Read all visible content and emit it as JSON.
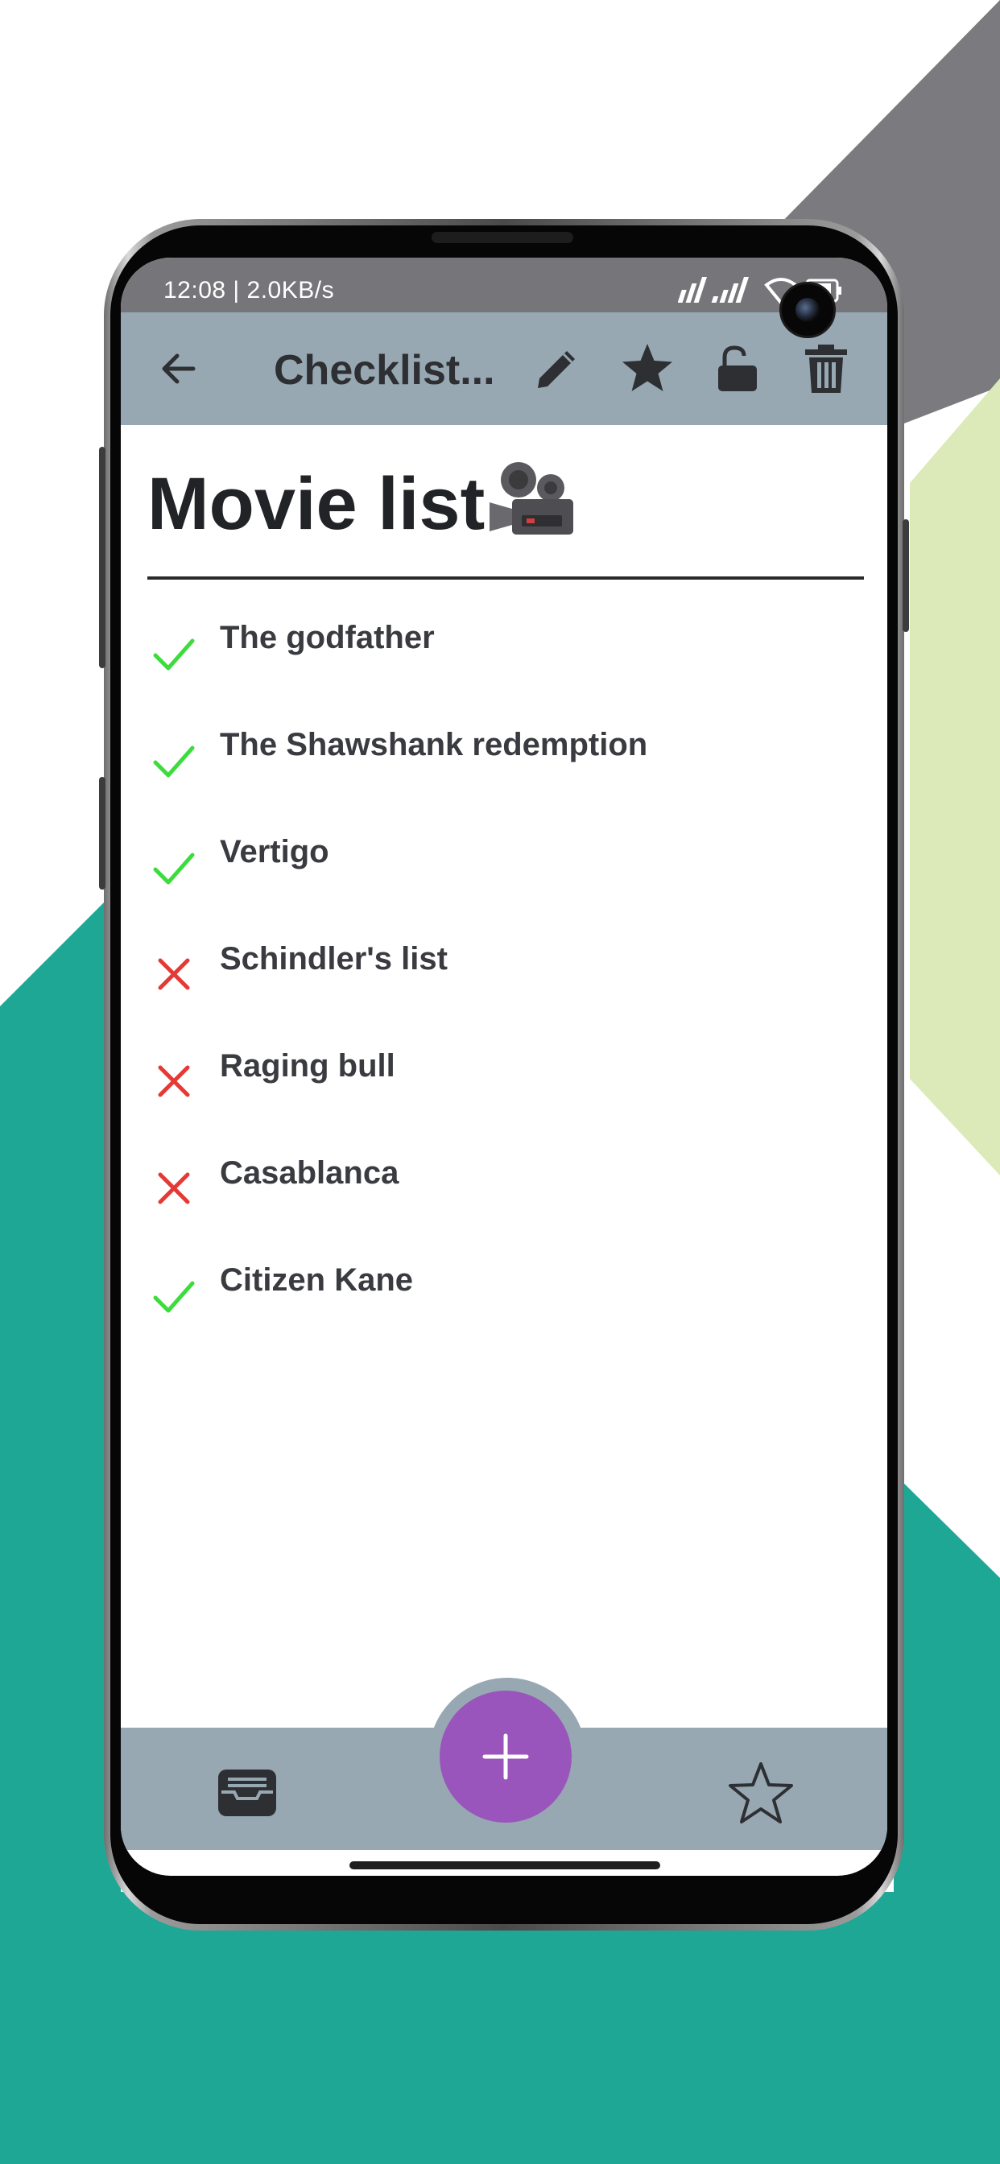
{
  "status_bar": {
    "time_speed": "12:08 | 2.0KB/s",
    "icons": [
      "signal-icon",
      "signal-icon",
      "wifi-icon",
      "battery-icon"
    ]
  },
  "app_bar": {
    "title": "Checklist...",
    "icons": [
      "back-arrow-icon",
      "pencil-icon",
      "star-filled-icon",
      "unlock-icon",
      "trash-icon"
    ]
  },
  "note": {
    "title": "Movie list",
    "title_emoji": "movie-camera-icon",
    "items": [
      {
        "text": "The godfather",
        "checked": true
      },
      {
        "text": "The Shawshank redemption",
        "checked": true
      },
      {
        "text": "Vertigo",
        "checked": true
      },
      {
        "text": "Schindler's list",
        "checked": false
      },
      {
        "text": "Raging bull",
        "checked": false
      },
      {
        "text": "Casablanca",
        "checked": false
      },
      {
        "text": "Citizen Kane",
        "checked": true
      }
    ]
  },
  "bottom_bar": {
    "icons": [
      "inbox-tray-icon",
      "plus-icon",
      "star-outline-icon"
    ]
  },
  "colors": {
    "app_bar": "#97a8b3",
    "fab": "#9955bb",
    "checked": "#3ddc3d",
    "unchecked": "#e53935",
    "background_teal": "#1fa795",
    "background_gray": "#7b7a7e",
    "background_lime": "#dce9b9"
  }
}
